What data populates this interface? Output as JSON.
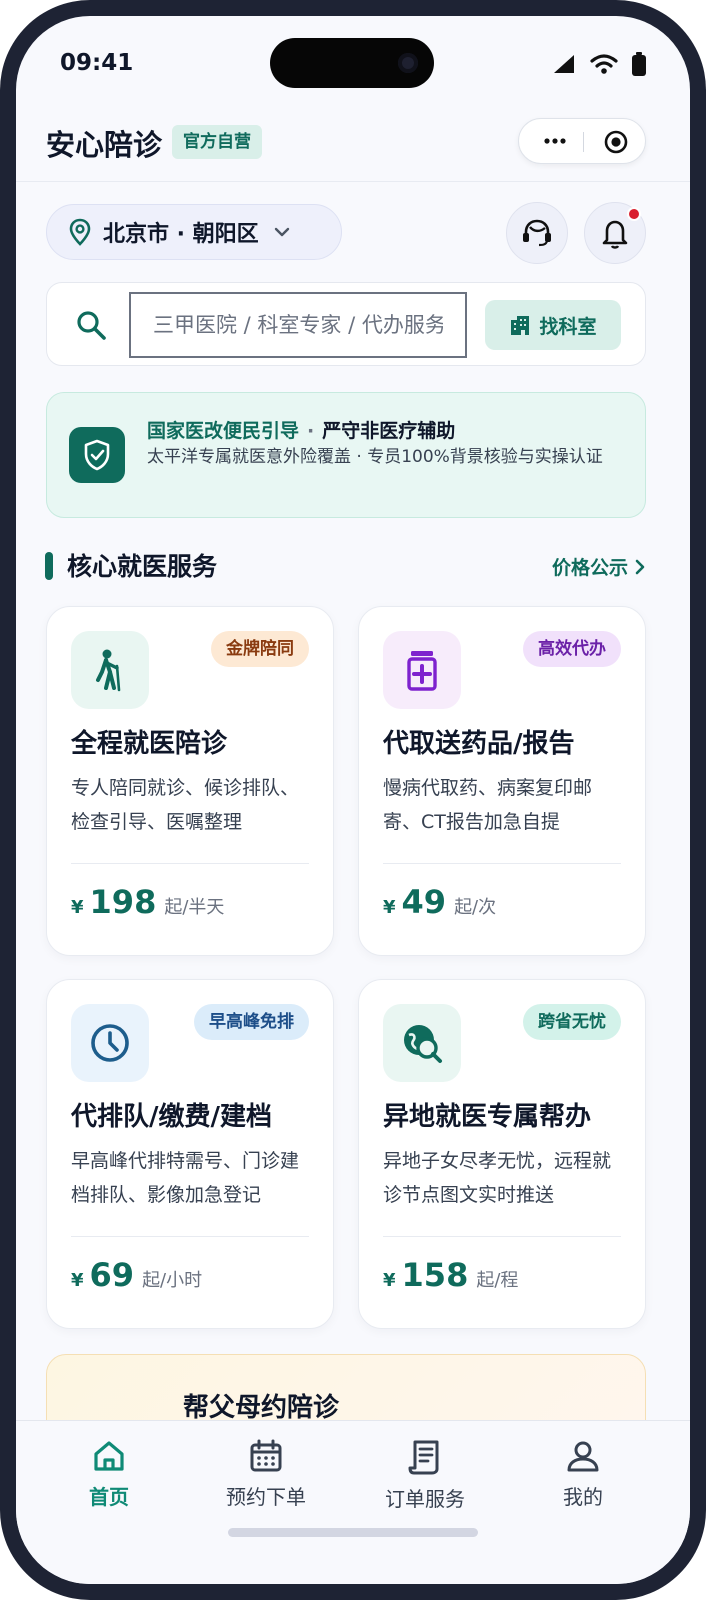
{
  "status_bar": {
    "time": "09:41"
  },
  "header": {
    "title": "安心陪诊",
    "badge": "官方自营"
  },
  "location": {
    "city": "北京市 · 朝阳区"
  },
  "search": {
    "placeholder": "三甲医院 / 科室专家 / 代办服务",
    "find_department": "找科室"
  },
  "notice": {
    "title_green": "国家医改便民引导",
    "separator": "·",
    "title_dark": "严守非医疗辅助",
    "description": "太平洋专属就医意外险覆盖 · 专员100%背景核验与实操认证"
  },
  "section": {
    "title": "核心就医服务",
    "link": "价格公示"
  },
  "currency": "¥",
  "services": [
    {
      "icon": "walking-person-icon",
      "tag": "金牌陪同",
      "title": "全程就医陪诊",
      "description": "专人陪同就诊、候诊排队、检查引导、医嘱整理",
      "price": "198",
      "unit": "起/半天",
      "icon_bg": "#e9f6f2",
      "icon_color": "#0f6b5c",
      "tag_bg": "#fde9d4",
      "tag_color": "#8a3b10"
    },
    {
      "icon": "medicine-bottle-icon",
      "tag": "高效代办",
      "title": "代取送药品/报告",
      "description": "慢病代取药、病案复印邮寄、CT报告加急自提",
      "price": "49",
      "unit": "起/次",
      "icon_bg": "#f7ecfb",
      "icon_color": "#7e22ce",
      "tag_bg": "#f1e1fb",
      "tag_color": "#6b21a8"
    },
    {
      "icon": "clock-icon",
      "tag": "早高峰免排",
      "title": "代排队/缴费/建档",
      "description": "早高峰代排特需号、门诊建档排队、影像加急登记",
      "price": "69",
      "unit": "起/小时",
      "icon_bg": "#e9f3fc",
      "icon_color": "#1d5d8c",
      "tag_bg": "#dbecfa",
      "tag_color": "#1d4e89"
    },
    {
      "icon": "globe-search-icon",
      "tag": "跨省无忧",
      "title": "异地就医专属帮办",
      "description": "异地子女尽孝无忧，远程就诊节点图文实时推送",
      "price": "158",
      "unit": "起/程",
      "icon_bg": "#e9f6f2",
      "icon_color": "#0f6b5c",
      "tag_bg": "#d3f2ea",
      "tag_color": "#0f6b5c"
    }
  ],
  "banner": {
    "title": "帮父母约陪诊"
  },
  "tabs": [
    {
      "label": "首页",
      "icon": "home-icon",
      "active": true
    },
    {
      "label": "预约下单",
      "icon": "calendar-icon",
      "active": false
    },
    {
      "label": "订单服务",
      "icon": "receipt-icon",
      "active": false
    },
    {
      "label": "我的",
      "icon": "user-icon",
      "active": false
    }
  ],
  "colors": {
    "brand": "#0f6b5c",
    "tab_active": "#0f8a76",
    "notification": "#d9202f"
  }
}
